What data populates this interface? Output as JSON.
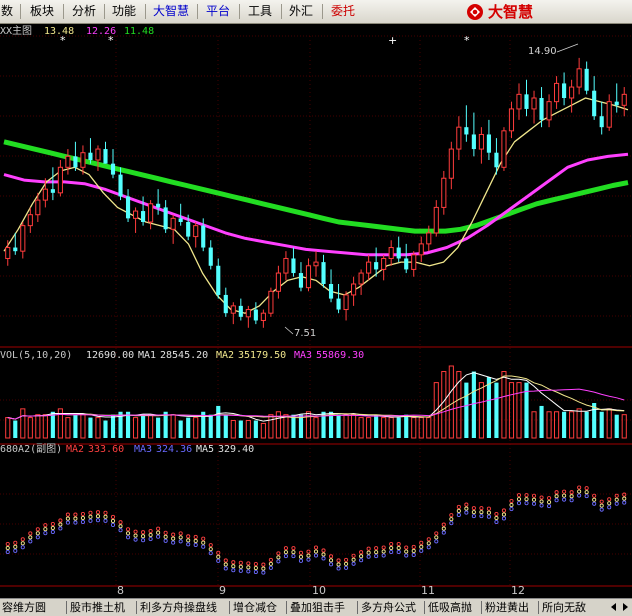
{
  "menu": {
    "items": [
      {
        "label": "数",
        "color": "#000000"
      },
      {
        "label": "板块",
        "color": "#000000"
      },
      {
        "label": "分析",
        "color": "#000000"
      },
      {
        "label": "功能",
        "color": "#000000"
      },
      {
        "label": "大智慧",
        "color": "#0000cc"
      },
      {
        "label": "平台",
        "color": "#0000cc"
      },
      {
        "label": "工具",
        "color": "#000000"
      },
      {
        "label": "外汇",
        "color": "#000000"
      },
      {
        "label": "委托",
        "color": "#cc0000"
      }
    ],
    "logo_text": "大智慧"
  },
  "main_panel": {
    "title": "XX主图",
    "ma_values": [
      {
        "value": "13.48",
        "color": "#f0e68c"
      },
      {
        "value": "12.26",
        "color": "#ff40ff"
      },
      {
        "value": "11.48",
        "color": "#22dd22"
      }
    ],
    "high_label": "14.90",
    "low_label": "7.51"
  },
  "volume_panel": {
    "title": "VOL(5,10,20)",
    "value": "12690.00",
    "ma1_label": "MA1",
    "ma1_value": "28545.20",
    "ma2_label": "MA2",
    "ma2_value": "35179.50",
    "ma3_label": "MA3",
    "ma3_value": "55869.30"
  },
  "indicator_panel": {
    "title": "680A2(副图)",
    "ma2_label": "MA2",
    "ma2_value": "333.60",
    "ma3_label": "MA3",
    "ma3_value": "324.36",
    "ma5_label": "MA5",
    "ma5_value": "329.40"
  },
  "x_axis": {
    "month_labels": [
      "8",
      "9",
      "10",
      "11",
      "12"
    ]
  },
  "bottom_tabs": [
    "容维方圆",
    "股市推土机",
    "利多方舟操盘线",
    "增仓减仓",
    "叠加狙击手",
    "多方舟公式",
    "低吸高抛",
    "粉进黄出",
    "所向无敌"
  ],
  "colors": {
    "up": "#ff3c3c",
    "down": "#54ffff",
    "ma_short": "#f0e68c",
    "ma_mid": "#ff40ff",
    "ma_long": "#22dd22",
    "grid": "#8b0000"
  },
  "chart_data": {
    "type": "candlestick",
    "y_range": [
      7.0,
      15.5
    ],
    "candles": [
      {
        "o": 9.4,
        "h": 9.9,
        "l": 9.2,
        "c": 9.7
      },
      {
        "o": 9.7,
        "h": 10.1,
        "l": 9.5,
        "c": 9.6
      },
      {
        "o": 9.6,
        "h": 10.4,
        "l": 9.4,
        "c": 10.3
      },
      {
        "o": 10.3,
        "h": 10.8,
        "l": 10.1,
        "c": 10.6
      },
      {
        "o": 10.6,
        "h": 11.2,
        "l": 10.4,
        "c": 11.0
      },
      {
        "o": 11.0,
        "h": 11.6,
        "l": 10.8,
        "c": 11.3
      },
      {
        "o": 11.3,
        "h": 11.9,
        "l": 11.0,
        "c": 11.2
      },
      {
        "o": 11.2,
        "h": 12.1,
        "l": 11.1,
        "c": 11.9
      },
      {
        "o": 11.9,
        "h": 12.4,
        "l": 11.7,
        "c": 12.2
      },
      {
        "o": 12.2,
        "h": 12.6,
        "l": 11.8,
        "c": 11.9
      },
      {
        "o": 11.9,
        "h": 12.5,
        "l": 11.7,
        "c": 12.3
      },
      {
        "o": 12.3,
        "h": 12.7,
        "l": 12.0,
        "c": 12.1
      },
      {
        "o": 12.1,
        "h": 12.5,
        "l": 11.8,
        "c": 12.4
      },
      {
        "o": 12.4,
        "h": 12.6,
        "l": 12.0,
        "c": 12.0
      },
      {
        "o": 12.0,
        "h": 12.4,
        "l": 11.6,
        "c": 11.7
      },
      {
        "o": 11.7,
        "h": 11.9,
        "l": 11.0,
        "c": 11.1
      },
      {
        "o": 11.1,
        "h": 11.3,
        "l": 10.4,
        "c": 10.5
      },
      {
        "o": 10.5,
        "h": 10.8,
        "l": 10.1,
        "c": 10.7
      },
      {
        "o": 10.7,
        "h": 11.1,
        "l": 10.3,
        "c": 10.4
      },
      {
        "o": 10.4,
        "h": 11.0,
        "l": 10.2,
        "c": 10.9
      },
      {
        "o": 10.9,
        "h": 11.3,
        "l": 10.6,
        "c": 10.8
      },
      {
        "o": 10.8,
        "h": 11.0,
        "l": 10.1,
        "c": 10.2
      },
      {
        "o": 10.2,
        "h": 10.6,
        "l": 9.8,
        "c": 10.5
      },
      {
        "o": 10.5,
        "h": 10.9,
        "l": 10.3,
        "c": 10.4
      },
      {
        "o": 10.4,
        "h": 10.6,
        "l": 9.9,
        "c": 10.0
      },
      {
        "o": 10.0,
        "h": 10.4,
        "l": 9.7,
        "c": 10.3
      },
      {
        "o": 10.3,
        "h": 10.5,
        "l": 9.6,
        "c": 9.7
      },
      {
        "o": 9.7,
        "h": 9.9,
        "l": 9.1,
        "c": 9.2
      },
      {
        "o": 9.2,
        "h": 9.4,
        "l": 8.3,
        "c": 8.4
      },
      {
        "o": 8.4,
        "h": 8.6,
        "l": 7.8,
        "c": 7.9
      },
      {
        "o": 7.9,
        "h": 8.2,
        "l": 7.6,
        "c": 8.1
      },
      {
        "o": 8.1,
        "h": 8.3,
        "l": 7.7,
        "c": 7.8
      },
      {
        "o": 7.8,
        "h": 8.1,
        "l": 7.5,
        "c": 8.0
      },
      {
        "o": 8.0,
        "h": 8.2,
        "l": 7.6,
        "c": 7.7
      },
      {
        "o": 7.7,
        "h": 8.0,
        "l": 7.5,
        "c": 7.9
      },
      {
        "o": 7.9,
        "h": 8.6,
        "l": 7.8,
        "c": 8.5
      },
      {
        "o": 8.5,
        "h": 9.2,
        "l": 8.3,
        "c": 9.0
      },
      {
        "o": 9.0,
        "h": 9.6,
        "l": 8.8,
        "c": 9.4
      },
      {
        "o": 9.4,
        "h": 9.7,
        "l": 8.9,
        "c": 9.0
      },
      {
        "o": 9.0,
        "h": 9.3,
        "l": 8.5,
        "c": 8.6
      },
      {
        "o": 8.6,
        "h": 9.4,
        "l": 8.5,
        "c": 9.2
      },
      {
        "o": 9.2,
        "h": 9.6,
        "l": 8.9,
        "c": 9.3
      },
      {
        "o": 9.3,
        "h": 9.5,
        "l": 8.6,
        "c": 8.7
      },
      {
        "o": 8.7,
        "h": 9.1,
        "l": 8.2,
        "c": 8.3
      },
      {
        "o": 8.3,
        "h": 8.7,
        "l": 7.9,
        "c": 8.0
      },
      {
        "o": 8.0,
        "h": 8.5,
        "l": 7.7,
        "c": 8.4
      },
      {
        "o": 8.4,
        "h": 8.9,
        "l": 8.1,
        "c": 8.7
      },
      {
        "o": 8.7,
        "h": 9.1,
        "l": 8.4,
        "c": 9.0
      },
      {
        "o": 9.0,
        "h": 9.5,
        "l": 8.8,
        "c": 9.3
      },
      {
        "o": 9.3,
        "h": 9.7,
        "l": 8.9,
        "c": 9.1
      },
      {
        "o": 9.1,
        "h": 9.5,
        "l": 8.8,
        "c": 9.4
      },
      {
        "o": 9.4,
        "h": 9.9,
        "l": 9.2,
        "c": 9.7
      },
      {
        "o": 9.7,
        "h": 10.0,
        "l": 9.3,
        "c": 9.4
      },
      {
        "o": 9.4,
        "h": 9.8,
        "l": 9.0,
        "c": 9.1
      },
      {
        "o": 9.1,
        "h": 9.6,
        "l": 8.9,
        "c": 9.5
      },
      {
        "o": 9.5,
        "h": 10.0,
        "l": 9.3,
        "c": 9.8
      },
      {
        "o": 9.8,
        "h": 10.3,
        "l": 9.6,
        "c": 10.1
      },
      {
        "o": 10.1,
        "h": 11.0,
        "l": 10.0,
        "c": 10.8
      },
      {
        "o": 10.8,
        "h": 11.8,
        "l": 10.6,
        "c": 11.6
      },
      {
        "o": 11.6,
        "h": 12.6,
        "l": 11.3,
        "c": 12.4
      },
      {
        "o": 12.4,
        "h": 13.3,
        "l": 12.1,
        "c": 13.0
      },
      {
        "o": 13.0,
        "h": 13.6,
        "l": 12.6,
        "c": 12.8
      },
      {
        "o": 12.8,
        "h": 13.4,
        "l": 12.2,
        "c": 12.4
      },
      {
        "o": 12.4,
        "h": 13.0,
        "l": 12.0,
        "c": 12.8
      },
      {
        "o": 12.8,
        "h": 13.2,
        "l": 12.1,
        "c": 12.3
      },
      {
        "o": 12.3,
        "h": 12.7,
        "l": 11.7,
        "c": 11.9
      },
      {
        "o": 11.9,
        "h": 13.0,
        "l": 11.8,
        "c": 12.9
      },
      {
        "o": 12.9,
        "h": 13.7,
        "l": 12.7,
        "c": 13.5
      },
      {
        "o": 13.5,
        "h": 14.2,
        "l": 13.2,
        "c": 13.9
      },
      {
        "o": 13.9,
        "h": 14.3,
        "l": 13.3,
        "c": 13.5
      },
      {
        "o": 13.5,
        "h": 14.0,
        "l": 13.1,
        "c": 13.8
      },
      {
        "o": 13.8,
        "h": 14.1,
        "l": 13.0,
        "c": 13.2
      },
      {
        "o": 13.2,
        "h": 13.9,
        "l": 13.0,
        "c": 13.7
      },
      {
        "o": 13.7,
        "h": 14.4,
        "l": 13.5,
        "c": 14.2
      },
      {
        "o": 14.2,
        "h": 14.5,
        "l": 13.6,
        "c": 13.8
      },
      {
        "o": 13.8,
        "h": 14.3,
        "l": 13.4,
        "c": 14.1
      },
      {
        "o": 14.1,
        "h": 14.9,
        "l": 13.9,
        "c": 14.6
      },
      {
        "o": 14.6,
        "h": 14.8,
        "l": 13.9,
        "c": 14.0
      },
      {
        "o": 14.0,
        "h": 14.4,
        "l": 13.2,
        "c": 13.3
      },
      {
        "o": 13.3,
        "h": 13.7,
        "l": 12.8,
        "c": 13.0
      },
      {
        "o": 13.0,
        "h": 13.9,
        "l": 12.9,
        "c": 13.7
      },
      {
        "o": 13.7,
        "h": 14.2,
        "l": 13.4,
        "c": 13.6
      },
      {
        "o": 13.6,
        "h": 14.1,
        "l": 13.3,
        "c": 13.9
      }
    ],
    "ma_long": [
      12.6,
      12.5,
      12.4,
      12.3,
      12.2,
      12.1,
      12.0,
      11.9,
      11.8,
      11.7,
      11.6,
      11.5,
      11.4,
      11.3,
      11.2,
      11.1,
      11.0,
      10.9,
      10.8,
      10.7,
      10.6,
      10.5,
      10.4,
      10.35,
      10.3,
      10.25,
      10.2,
      10.15,
      10.15,
      10.15,
      10.2,
      10.3,
      10.45,
      10.6,
      10.75,
      10.9,
      11.0,
      11.1,
      11.2,
      11.3,
      11.4,
      11.48
    ],
    "ma_mid": [
      11.7,
      11.55,
      11.5,
      11.5,
      11.45,
      11.3,
      11.1,
      10.9,
      10.7,
      10.5,
      10.3,
      10.1,
      9.95,
      9.85,
      9.75,
      9.65,
      9.6,
      9.55,
      9.5,
      9.5,
      9.5,
      9.55,
      9.7,
      9.95,
      10.3,
      10.7,
      11.1,
      11.5,
      11.9,
      12.1,
      12.2,
      12.26
    ],
    "ma_short_points": [
      9.6,
      10.2,
      10.9,
      11.5,
      11.8,
      11.9,
      11.7,
      11.2,
      10.8,
      10.6,
      10.4,
      10.3,
      10.2,
      9.8,
      9.0,
      8.4,
      8.0,
      7.9,
      8.1,
      8.5,
      8.8,
      8.9,
      8.8,
      8.5,
      8.4,
      8.6,
      8.9,
      9.2,
      9.3,
      9.3,
      9.2,
      9.3,
      9.7,
      10.4,
      11.2,
      12.0,
      12.6,
      12.9,
      13.2,
      13.4,
      13.6,
      13.8,
      13.7,
      13.6,
      13.48
    ]
  }
}
